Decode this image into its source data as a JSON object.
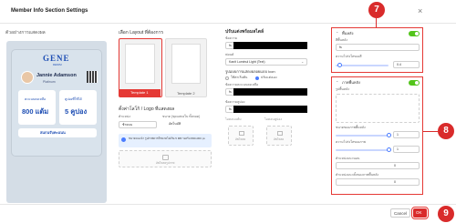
{
  "dialog": {
    "title": "Member Info Section Settings",
    "close_glyph": "×"
  },
  "preview": {
    "heading": "ตัวอย่างการแสดงผล",
    "brand": "GENE",
    "brand_sub": "DENIM",
    "member_name": "Jannie Adamson",
    "tier": "Platinum",
    "points_label": "คะแนนคงเหลือ",
    "points_value": "800 แต้ม",
    "coupons_label": "คูปองที่ใช้ได้",
    "coupons_value": "5 คูปอง",
    "footer": "สแกนรับคะแนน"
  },
  "layout": {
    "heading": "เลือก Layout ที่ต้องการ",
    "template1": "Template 1",
    "template2": "Template 2",
    "logo_heading": "ตั้งค่าโลโก้ / Logo ที่แสดงผล",
    "logo_col1_label": "ตำแหน่ง",
    "logo_col1_value": "ซ้ายบน",
    "logo_col2_label": "ขนาด (ชุดแสดงใน ทั้งหมด)",
    "logo_col2_value": "อัตโนมัติ",
    "info_text": "ขนาดแนะนำ รูปภาพควรมีขนาดไม่เกิน 5 MB รองรับ 800x300 px",
    "upload_label": "อัพโหลดรูปภาพ"
  },
  "middle": {
    "heading": "ปรับแต่งพร้อมสไตล์",
    "field1_label": "ข้อความ",
    "field1_prefix": "fs",
    "field2_label": "ฟอนต์",
    "field2_value": "Kanit Luminul Light (Text)",
    "section_label": "รูปแบบการแสดงผลอยแบบ Icon",
    "radio1": "ใช้ค่าเริ่มต้น",
    "radio2": "ปรับแต่งเอง",
    "field3_label": "ข้อความคะแนนคงเหลือ",
    "field3_prefix": "fs",
    "field4_label": "ข้อความคูปอง",
    "field4_prefix": "fs",
    "upload_caption1": "ไอคอนแต้ม",
    "upload_caption2": "ไอคอนคูปอง",
    "upload_button": "อัพโหลด"
  },
  "right": {
    "panel7_title": "พื้นหลัง",
    "panel7_field1_label": "สีพื้นหลัง",
    "panel7_field1_prefix": "fs",
    "panel7_slider_label": "ความโปร่งใสของสี",
    "panel7_slider_value": "0.4",
    "panel8_title": "ภาพพื้นหลัง",
    "panel8_image_label": "รูปพื้นหลัง",
    "panel8_slider1_label": "ขนาดของภาพพื้นหลัง",
    "panel8_slider1_value": "1",
    "panel8_slider2_label": "ความโปร่งใสของภาพ",
    "panel8_slider2_value": "1",
    "panel8_field1_label": "ตำแหน่งแนวนอน",
    "panel8_field1_value": "0",
    "panel8_field2_label": "ตำแหน่งแนวตั้งของภาพพื้นหลัง",
    "panel8_field2_value": "0"
  },
  "footer": {
    "cancel": "Cancel",
    "ok": "OK"
  },
  "callouts": {
    "c7": "7",
    "c8": "8",
    "c9": "9"
  },
  "colors": {
    "accent_red": "#d92b2b",
    "preview_blue": "#1f4fb4",
    "toggle_green": "#52c41a",
    "link_blue": "#4a7cff"
  }
}
